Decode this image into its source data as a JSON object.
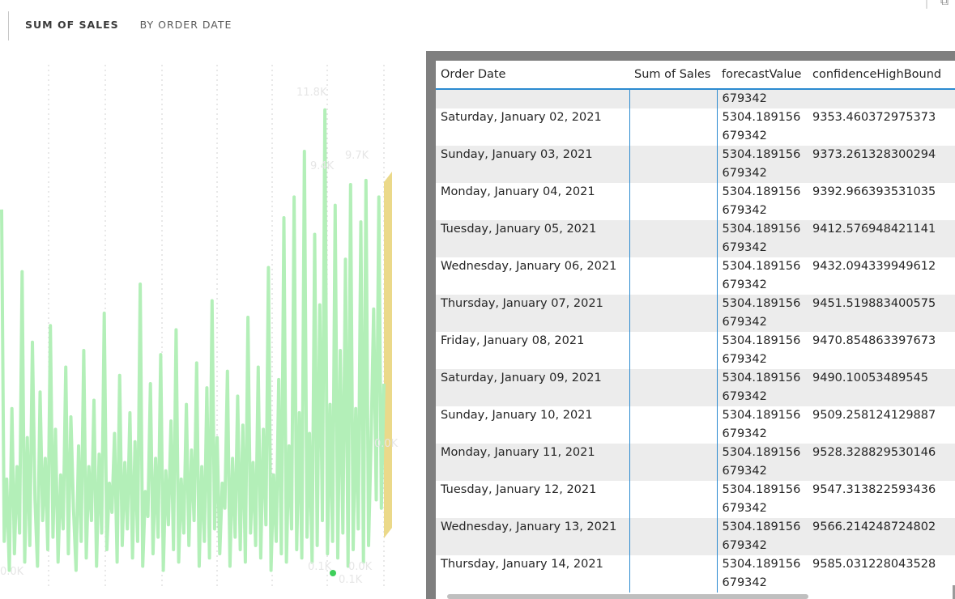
{
  "header": {
    "tabs": [
      {
        "label": "SUM OF SALES",
        "active": true
      },
      {
        "label": "BY ORDER DATE",
        "active": false
      }
    ]
  },
  "chart_data": {
    "type": "line",
    "title": "",
    "color_series": "#b3efb8",
    "color_forecast_band": "#ebd98a",
    "point_labels": [
      "11.8K",
      "9.4K",
      "9.7K",
      "0.0K",
      "0.1K",
      "0.1K",
      "0.0K",
      "0.0K"
    ],
    "ylim": [
      0,
      12000
    ],
    "series": [
      {
        "values": [
          9000,
          1000,
          2500,
          300,
          4200,
          700,
          2800,
          1200,
          7500,
          500,
          3500,
          900,
          5800,
          2000,
          400,
          4600,
          1500,
          3000,
          800,
          6200,
          1100,
          3700,
          500,
          2600,
          1300,
          5200,
          700,
          4000,
          1800,
          300,
          3300,
          1000,
          5600,
          600,
          2800,
          1500,
          4400,
          400,
          3100,
          1200,
          6500,
          800,
          2400,
          1700,
          3600,
          500,
          5000,
          900,
          2900,
          1300,
          4100,
          600,
          3400,
          1000,
          7200,
          400,
          2200,
          1600,
          4800,
          700,
          3000,
          1100,
          5500,
          300,
          2700,
          1400,
          3900,
          800,
          6100,
          500,
          2500,
          1200,
          4300,
          900,
          3200,
          1500,
          5300,
          400,
          2800,
          1000,
          4700,
          600,
          6800,
          1300,
          3500,
          700,
          2400,
          1800,
          5100,
          400,
          3000,
          1100,
          4500,
          800,
          3800,
          500,
          6400,
          1200,
          2900,
          900,
          5200,
          600,
          3700,
          1400,
          7600,
          300,
          2600,
          1000,
          4900,
          700,
          8800,
          500,
          3300,
          1300,
          9300,
          800,
          4100,
          600,
          10400,
          1100,
          3600,
          500,
          8400,
          900,
          6700,
          1500,
          11400,
          700,
          4300,
          1000,
          9100,
          600,
          5600,
          1200,
          7800,
          400,
          9600,
          800,
          4200,
          1300,
          8700,
          500,
          9700,
          900,
          3500,
          6600,
          2000,
          9300,
          1800,
          4800
        ]
      }
    ]
  },
  "table": {
    "columns": [
      "Order Date",
      "Sum of Sales",
      "forecastValue",
      "confidenceHighBound"
    ],
    "partial_row": {
      "date": "",
      "sales": "",
      "forecast_tail": "679342",
      "high": ""
    },
    "rows": [
      {
        "date": "Saturday, January 02, 2021",
        "sales": "",
        "forecast_a": "5304.189156",
        "forecast_b": "679342",
        "high": "9353.460372975373"
      },
      {
        "date": "Sunday, January 03, 2021",
        "sales": "",
        "forecast_a": "5304.189156",
        "forecast_b": "679342",
        "high": "9373.261328300294"
      },
      {
        "date": "Monday, January 04, 2021",
        "sales": "",
        "forecast_a": "5304.189156",
        "forecast_b": "679342",
        "high": "9392.966393531035"
      },
      {
        "date": "Tuesday, January 05, 2021",
        "sales": "",
        "forecast_a": "5304.189156",
        "forecast_b": "679342",
        "high": "9412.576948421141"
      },
      {
        "date": "Wednesday, January 06, 2021",
        "sales": "",
        "forecast_a": "5304.189156",
        "forecast_b": "679342",
        "high": "9432.094339949612"
      },
      {
        "date": "Thursday, January 07, 2021",
        "sales": "",
        "forecast_a": "5304.189156",
        "forecast_b": "679342",
        "high": "9451.519883400575"
      },
      {
        "date": "Friday, January 08, 2021",
        "sales": "",
        "forecast_a": "5304.189156",
        "forecast_b": "679342",
        "high": "9470.854863397673"
      },
      {
        "date": "Saturday, January 09, 2021",
        "sales": "",
        "forecast_a": "5304.189156",
        "forecast_b": "679342",
        "high": "9490.10053489545"
      },
      {
        "date": "Sunday, January 10, 2021",
        "sales": "",
        "forecast_a": "5304.189156",
        "forecast_b": "679342",
        "high": "9509.258124129887"
      },
      {
        "date": "Monday, January 11, 2021",
        "sales": "",
        "forecast_a": "5304.189156",
        "forecast_b": "679342",
        "high": "9528.328829530146"
      },
      {
        "date": "Tuesday, January 12, 2021",
        "sales": "",
        "forecast_a": "5304.189156",
        "forecast_b": "679342",
        "high": "9547.313822593436"
      },
      {
        "date": "Wednesday, January 13, 2021",
        "sales": "",
        "forecast_a": "5304.189156",
        "forecast_b": "679342",
        "high": "9566.214248724802"
      },
      {
        "date": "Thursday, January 14, 2021",
        "sales": "",
        "forecast_a": "5304.189156",
        "forecast_b": "679342",
        "high": "9585.031228043528"
      }
    ]
  }
}
